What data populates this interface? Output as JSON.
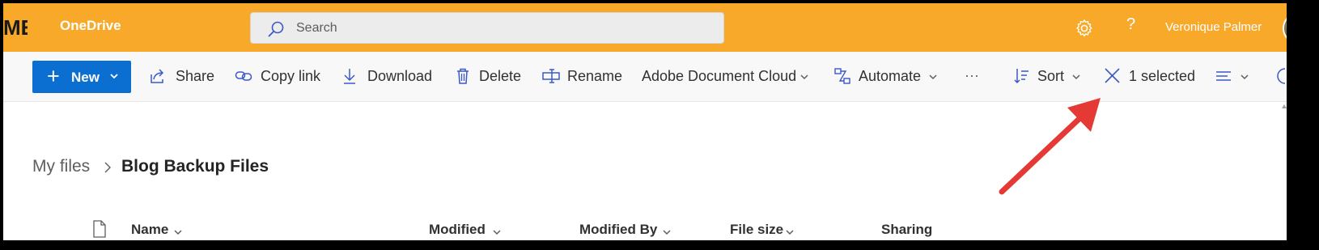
{
  "header": {
    "brand_fragment": "ME",
    "app_name": "OneDrive",
    "search_placeholder": "Search",
    "user_name": "Veronique Palmer",
    "help_label": "?"
  },
  "toolbar": {
    "new_label": "New",
    "share_label": "Share",
    "copy_link_label": "Copy link",
    "download_label": "Download",
    "delete_label": "Delete",
    "rename_label": "Rename",
    "adobe_label": "Adobe Document Cloud",
    "automate_label": "Automate",
    "more_label": "···",
    "sort_label": "Sort",
    "selected_label": "1 selected"
  },
  "breadcrumb": {
    "root": "My files",
    "current": "Blog Backup Files"
  },
  "columns": {
    "name": "Name",
    "modified": "Modified",
    "modified_by": "Modified By",
    "file_size": "File size",
    "sharing": "Sharing"
  },
  "colors": {
    "header_bg": "#f8a92a",
    "accent_blue": "#0b6fd1",
    "annotation_red": "#e53935"
  }
}
